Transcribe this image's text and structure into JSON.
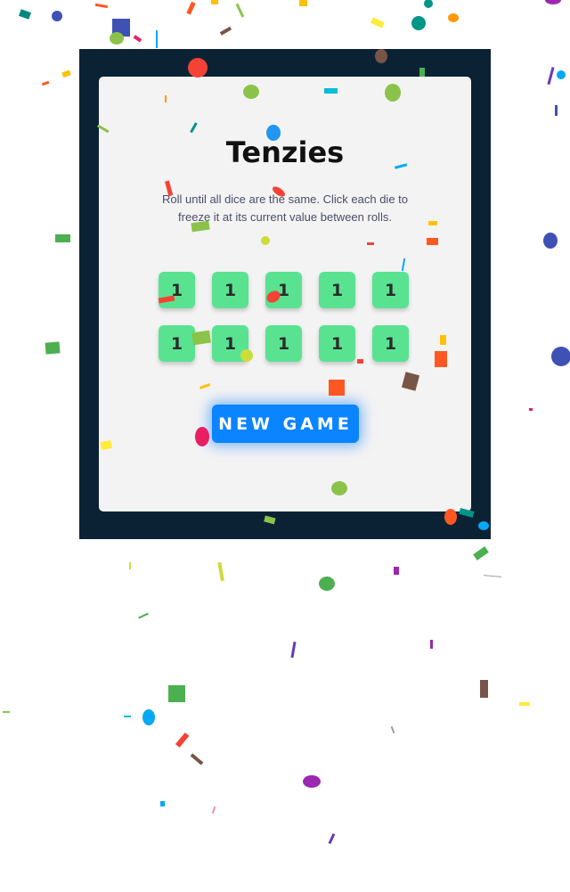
{
  "game": {
    "title": "Tenzies",
    "description": "Roll until all dice are the same. Click each die to freeze it at its current value between rolls.",
    "dice": [
      "1",
      "1",
      "1",
      "1",
      "1",
      "1",
      "1",
      "1",
      "1",
      "1"
    ],
    "new_game_label": "NEW GAME"
  },
  "colors": {
    "frame": "#0b2235",
    "card": "#f3f3f3",
    "die_held": "#59e391",
    "button": "#0b84ff"
  }
}
